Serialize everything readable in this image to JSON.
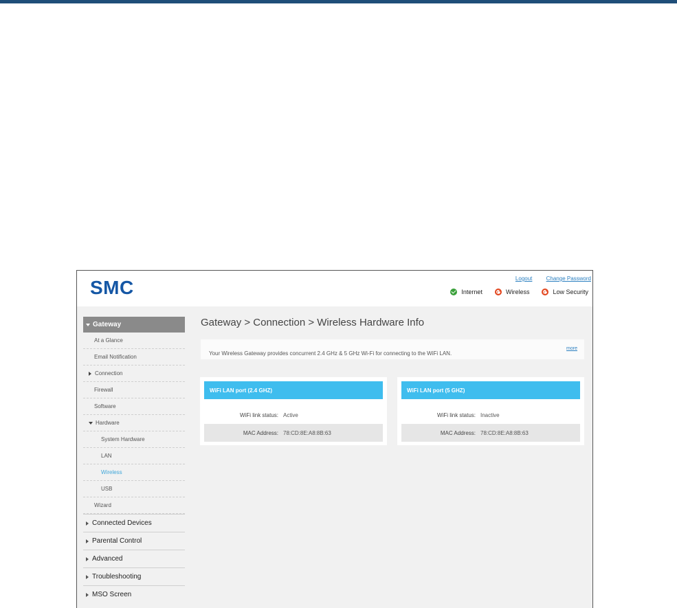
{
  "header": {
    "logo": "SMC",
    "logout": "Logout",
    "change_password": "Change Password",
    "status": [
      {
        "label": "Internet",
        "state": "ok"
      },
      {
        "label": "Wireless",
        "state": "bad"
      },
      {
        "label": "Low Security",
        "state": "bad"
      }
    ]
  },
  "sidebar": {
    "active_section": "Gateway",
    "items": [
      {
        "label": "At a Glance"
      },
      {
        "label": "Email Notification"
      },
      {
        "label": "Connection"
      },
      {
        "label": "Firewall"
      },
      {
        "label": "Software"
      },
      {
        "label": "Hardware"
      },
      {
        "label": "System Hardware"
      },
      {
        "label": "LAN"
      },
      {
        "label": "Wireless"
      },
      {
        "label": "USB"
      },
      {
        "label": "Wizard"
      }
    ],
    "sections": [
      {
        "label": "Connected Devices"
      },
      {
        "label": "Parental Control"
      },
      {
        "label": "Advanced"
      },
      {
        "label": "Troubleshooting"
      },
      {
        "label": "MSO Screen"
      }
    ]
  },
  "main": {
    "title": "Gateway > Connection > Wireless Hardware Info",
    "info": "Your Wireless Gateway provides concurrent 2.4 GHz & 5 GHz Wi-Fi for connecting to the WiFi LAN.",
    "more": "more",
    "cards": [
      {
        "title": "WiFi LAN port (2.4 GHZ)",
        "status_label": "WiFi link status:",
        "status_value": "Active",
        "mac_label": "MAC Address:",
        "mac_value": "78:CD:8E:A8:8B:63"
      },
      {
        "title": "WiFi LAN port (5 GHZ)",
        "status_label": "WiFi link status:",
        "status_value": "Inactive",
        "mac_label": "MAC Address:",
        "mac_value": "78:CD:8E:A8:8B:63"
      }
    ]
  }
}
